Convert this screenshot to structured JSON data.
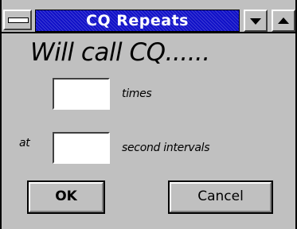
{
  "window": {
    "title": "CQ Repeats",
    "title_bar_color": "#1010c8",
    "system_menu_icon": "system-menu-bar-icon",
    "minimize_icon": "triangle-down-icon",
    "maximize_icon": "triangle-up-icon"
  },
  "dialog": {
    "heading": "Will call CQ......",
    "times_field": {
      "value": ""
    },
    "times_label": "times",
    "at_label": "at",
    "interval_field": {
      "value": ""
    },
    "interval_label": "second intervals"
  },
  "buttons": {
    "ok_label": "OK",
    "cancel_label": "Cancel"
  }
}
